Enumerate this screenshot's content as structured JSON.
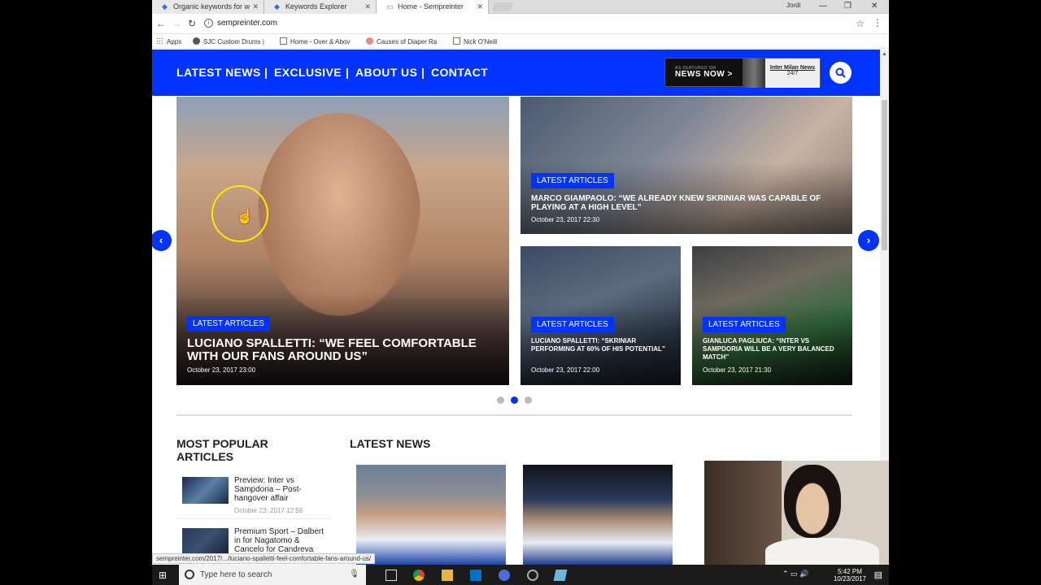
{
  "browser": {
    "tabs": [
      {
        "title": "Organic keywords for w"
      },
      {
        "title": "Keywords Explorer"
      },
      {
        "title": "Home - Sempreinter"
      }
    ],
    "user": "Jordi",
    "url": "sempreinter.com",
    "bookmarks": [
      "Apps",
      "SJC Custom Drums |",
      "Home - Over & Abov",
      "Causes of Diaper Ra",
      "Nick O'Neill"
    ],
    "status_url": "sempreinter.com/2017/.../luciano-spalletti-feel-comfortable-fans-around-us/"
  },
  "nav": {
    "links": [
      "LATEST NEWS",
      "EXCLUSIVE",
      "ABOUT US",
      "CONTACT"
    ],
    "separator": "|",
    "badge": {
      "small": "AS FEATURED ON",
      "name": "NEWS NOW >",
      "right_title": "Inter Milan News",
      "right_sub": "24/7"
    }
  },
  "hero": {
    "main": {
      "label": "LATEST ARTICLES",
      "title": "LUCIANO SPALLETTI: “WE FEEL COMFORTABLE WITH OUR FANS AROUND US”",
      "date": "October 23, 2017 23:00"
    },
    "top_right": {
      "label": "LATEST ARTICLES",
      "title": "MARCO GIAMPAOLO: “WE ALREADY KNEW SKRINIAR WAS CAPABLE OF PLAYING AT A HIGH LEVEL”",
      "date": "October 23, 2017 22:30"
    },
    "bottom_left": {
      "label": "LATEST ARTICLES",
      "title": "LUCIANO SPALLETTI: “SKRINIAR PERFORMING AT 60% OF HIS POTENTIAL”",
      "date": "October 23, 2017 22:00"
    },
    "bottom_right": {
      "label": "LATEST ARTICLES",
      "title": "GIANLUCA PAGLIUCA: “INTER VS SAMPDORIA WILL BE A VERY BALANCED MATCH”",
      "date": "October 23, 2017 21:30"
    },
    "prev": "‹",
    "next": "›",
    "active_dot": 2,
    "dot_count": 3
  },
  "popular": {
    "heading": "MOST POPULAR ARTICLES",
    "items": [
      {
        "title": "Preview: Inter vs Sampdoria – Post-hangover affair",
        "date": "October 23, 2017 12:58"
      },
      {
        "title": "Premium Sport – Dalbert in for Nagatomo & Cancelo for Candreva",
        "date": ""
      }
    ]
  },
  "latest": {
    "heading": "LATEST NEWS"
  },
  "taskbar": {
    "search_placeholder": "Type here to search",
    "time": "5:42 PM",
    "date": "10/23/2017"
  },
  "colors": {
    "brand": "#0033ff",
    "taskbar": "#1b1b1b"
  }
}
